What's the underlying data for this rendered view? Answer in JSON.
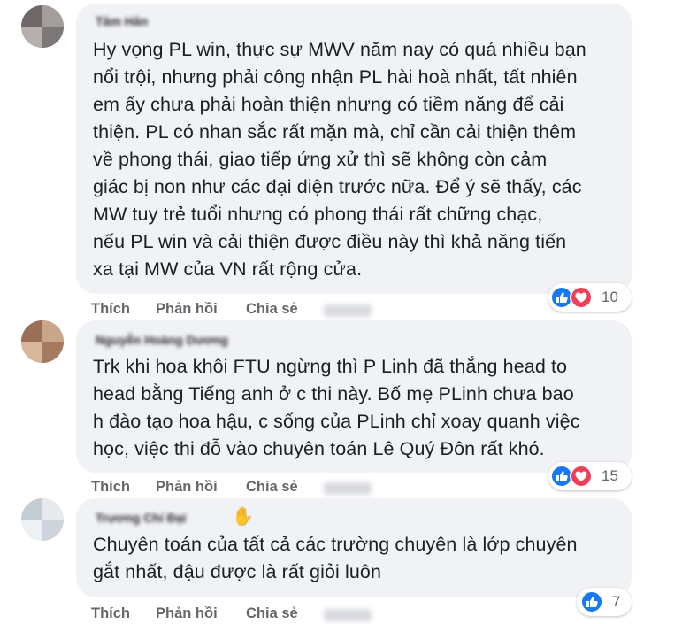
{
  "comments": [
    {
      "author": "Tâm Hân",
      "text": "Hy vọng PL win, thực sự MWV năm nay có quá nhiều bạn\nnổi trội, nhưng phải công nhận PL hài hoà nhất, tất nhiên\nem ấy chưa phải hoàn thiện nhưng có tiềm năng để cải\nthiện. PL có nhan sắc rất mặn mà, chỉ cần cải thiện thêm\nvề phong thái, giao tiếp ứng xử thì sẽ không còn cảm\ngiác bị non như các đại diện trước nữa. Để ý sẽ thấy, các\nMW tuy trẻ tuổi nhưng có phong thái rất chững chạc,\nnếu PL win và cải thiện được điều này thì khả năng tiến\nxa tại MW của VN rất rộng cửa.",
      "actions": {
        "like": "Thích",
        "reply": "Phản hồi",
        "share": "Chia sẻ"
      },
      "reaction_count": "10",
      "reaction_icons": [
        "like-icon",
        "love-icon"
      ]
    },
    {
      "author": "Nguyễn Hoàng Dương",
      "text": "Trk khi hoa khôi FTU ngừng thì P Linh đã thắng head to\nhead bằng Tiếng anh ở c thi này. Bố mẹ PLinh chưa bao\nh đào tạo hoa hậu, c sống của PLinh chỉ xoay quanh việc\nhọc, việc thi đỗ vào chuyên toán Lê Quý Đôn rất khó.",
      "actions": {
        "like": "Thích",
        "reply": "Phản hồi",
        "share": "Chia sẻ"
      },
      "reaction_count": "15",
      "reaction_icons": [
        "like-icon",
        "love-icon"
      ]
    },
    {
      "author": "Trương Chí Đại",
      "text": "Chuyên toán của tất cả các trường chuyên là lớp chuyên\ngắt nhất, đậu được là rất giỏi luôn",
      "actions": {
        "like": "Thích",
        "reply": "Phản hồi",
        "share": "Chia sẻ"
      },
      "reaction_count": "7",
      "reaction_icons": [
        "like-icon"
      ]
    }
  ],
  "colors": {
    "bubble": "#f0f2f5",
    "like": "#1877f2",
    "love": "#f33e58",
    "action_text": "#65676b"
  }
}
